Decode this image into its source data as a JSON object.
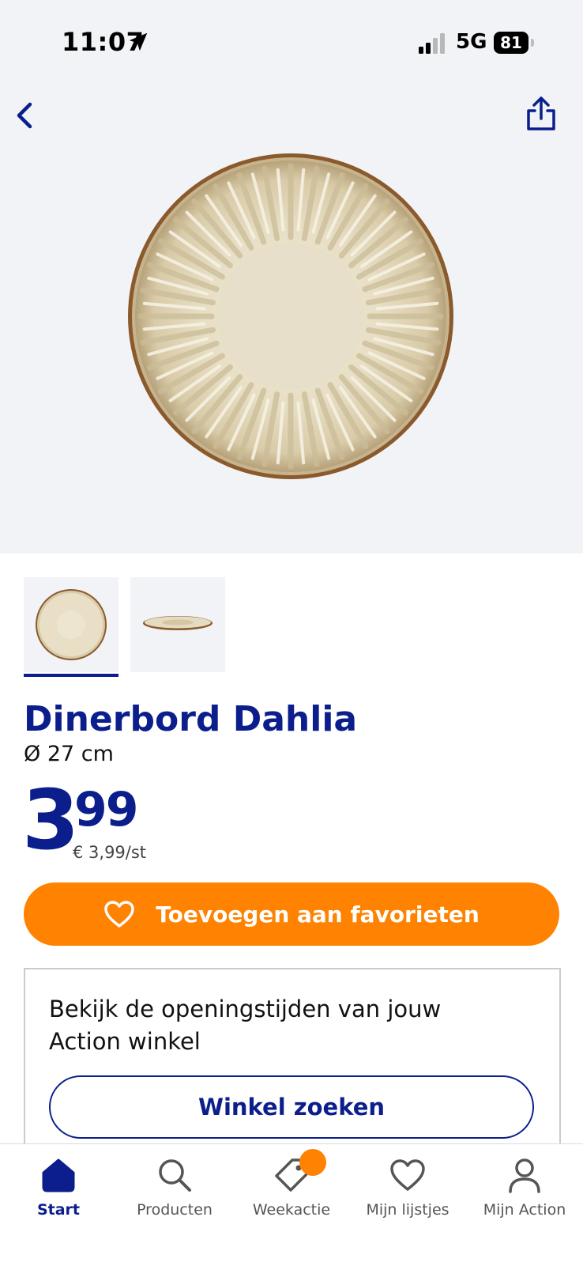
{
  "status_bar": {
    "time": "11:07",
    "network": "5G",
    "battery": "81",
    "icons": [
      "location-arrow-icon",
      "signal-bars-icon",
      "battery-icon"
    ]
  },
  "header": {
    "back_icon": "chevron-left-icon",
    "share_icon": "share-icon"
  },
  "product": {
    "name": "Dinerbord Dahlia",
    "size": "Ø 27 cm",
    "price_int": "3",
    "price_dec": "99",
    "unit_price": "€ 3,99/st",
    "favorite_label": "Toevoegen aan favorieten",
    "favorite_icon": "heart-icon",
    "thumbnails": [
      "plate-top-view",
      "plate-side-view"
    ],
    "selected_thumbnail": 0
  },
  "store": {
    "text": "Bekijk de openingstijden van jouw Action winkel",
    "button_label": "Winkel zoeken"
  },
  "tabbar": {
    "items": [
      {
        "label": "Start",
        "icon": "home-icon",
        "active": true
      },
      {
        "label": "Producten",
        "icon": "search-icon",
        "active": false
      },
      {
        "label": "Weekactie",
        "icon": "tag-icon",
        "active": false,
        "badge": true
      },
      {
        "label": "Mijn lijstjes",
        "icon": "heart-icon",
        "active": false
      },
      {
        "label": "Mijn Action",
        "icon": "user-icon",
        "active": false
      }
    ]
  },
  "colors": {
    "brand_blue": "#0b1e8c",
    "accent_orange": "#ff8200",
    "hero_bg": "#f2f3f6"
  }
}
